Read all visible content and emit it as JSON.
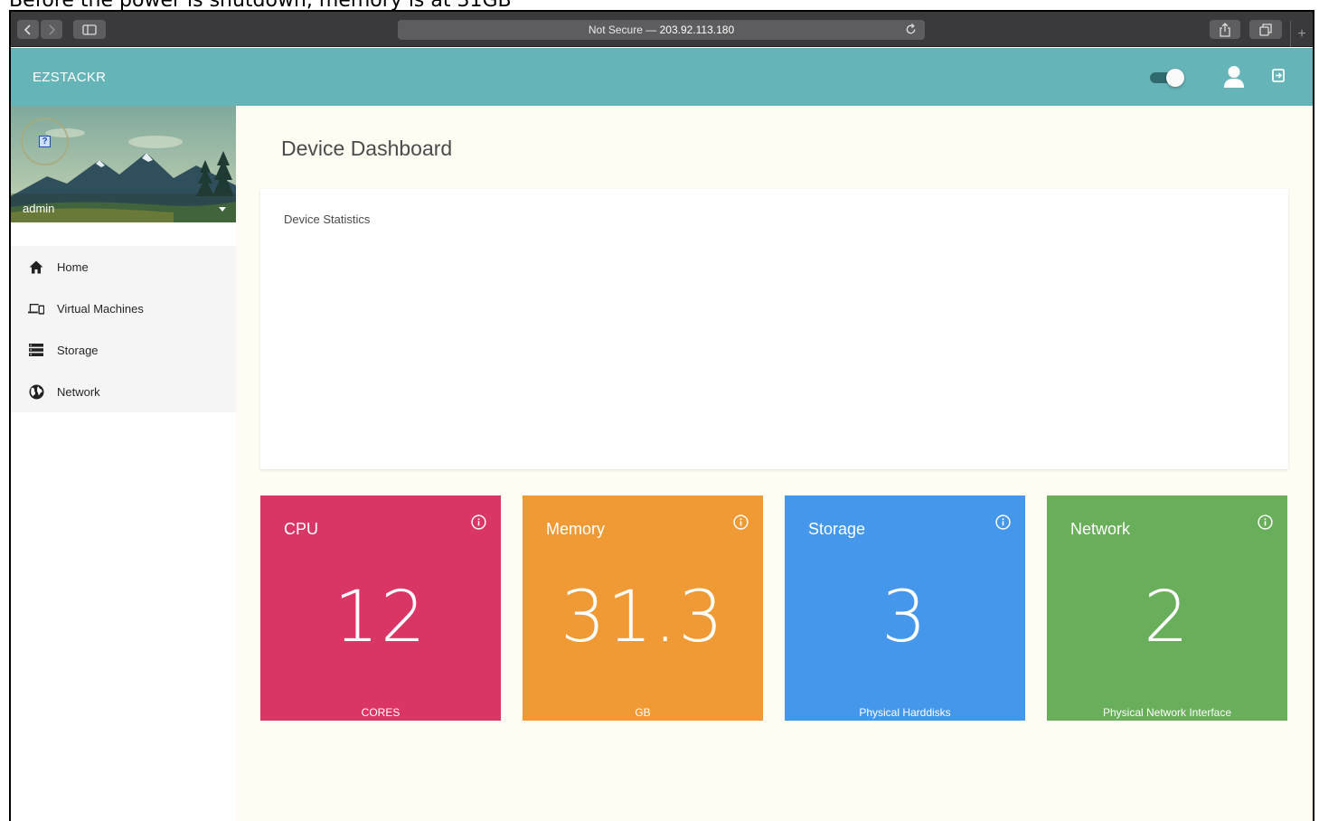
{
  "caption": "Before the power is shutdown, memory is at 31GB",
  "browser": {
    "address_prefix": "Not Secure —",
    "address_host": "203.92.113.180",
    "new_tab_symbol": "+"
  },
  "header": {
    "brand": "EZSTACKR",
    "theme_toggle_on": true,
    "accent_color": "#65b4b8"
  },
  "sidebar": {
    "user_name": "admin",
    "avatar_placeholder": "?",
    "items": [
      {
        "label": "Home",
        "icon": "home-icon"
      },
      {
        "label": "Virtual Machines",
        "icon": "devices-icon"
      },
      {
        "label": "Storage",
        "icon": "storage-icon"
      },
      {
        "label": "Network",
        "icon": "globe-icon"
      }
    ]
  },
  "main": {
    "title": "Device Dashboard",
    "stats_card_label": "Device Statistics",
    "tiles": [
      {
        "title": "CPU",
        "value": "12",
        "unit": "CORES",
        "color": "#d93665"
      },
      {
        "title": "Memory",
        "value": "31.3",
        "unit": "GB",
        "color": "#f09a36"
      },
      {
        "title": "Storage",
        "value": "3",
        "unit": "Physical Harddisks",
        "color": "#4597eb"
      },
      {
        "title": "Network",
        "value": "2",
        "unit": "Physical Network Interface",
        "color": "#69ae5a"
      }
    ]
  }
}
